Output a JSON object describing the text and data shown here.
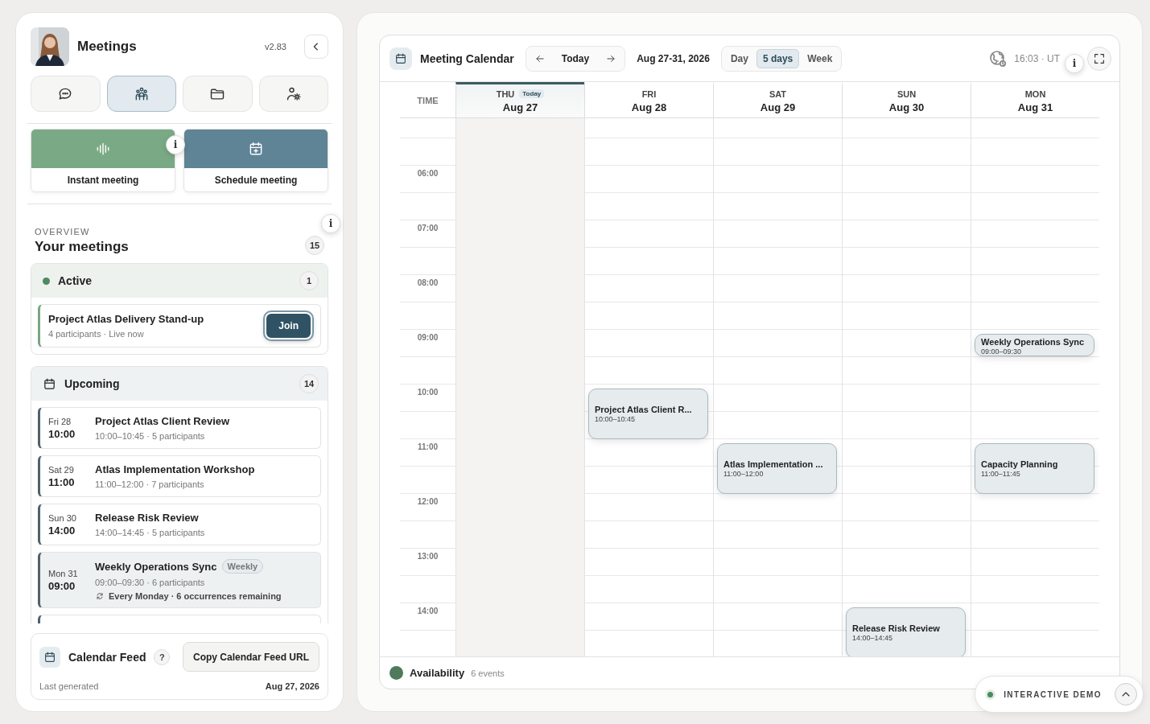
{
  "sidebar": {
    "title": "Meetings",
    "version": "v2.83",
    "tabs": [
      {
        "kind": "chat",
        "selected": false
      },
      {
        "kind": "people",
        "selected": true
      },
      {
        "kind": "folder",
        "selected": false
      },
      {
        "kind": "user-settings",
        "selected": false
      }
    ]
  },
  "actions": [
    {
      "kind": "instant",
      "label": "Instant meeting",
      "info": "i"
    },
    {
      "kind": "schedule",
      "label": "Schedule meeting"
    }
  ],
  "overview": {
    "eyebrow": "OVERVIEW",
    "title": "Your meetings",
    "count": "15",
    "info": "i"
  },
  "active": {
    "title": "Active",
    "count": "1",
    "items": [
      {
        "title": "Project Atlas Delivery Stand-up",
        "meta": "4 participants · Live now",
        "action": "Join"
      }
    ]
  },
  "upcoming": {
    "title": "Upcoming",
    "count": "14",
    "items": [
      {
        "day": "Fri 28",
        "time": "10:00",
        "title": "Project Atlas Client Review",
        "meta": "10:00–10:45 · 5 participants",
        "selected": false
      },
      {
        "day": "Sat 29",
        "time": "11:00",
        "title": "Atlas Implementation Workshop",
        "meta": "11:00–12:00 · 7 participants",
        "selected": false
      },
      {
        "day": "Sun 30",
        "time": "14:00",
        "title": "Release Risk Review",
        "meta": "14:00–14:45 · 5 participants",
        "selected": false
      },
      {
        "day": "Mon 31",
        "time": "09:00",
        "title": "Weekly Operations Sync",
        "badge": "Weekly",
        "meta": "09:00–09:30 · 6 participants",
        "recurrence": "Every Monday · 6 occurrences remaining",
        "selected": true
      }
    ]
  },
  "calendar_feed": {
    "title": "Calendar Feed",
    "help": "?",
    "button": "Copy Calendar Feed URL",
    "caption": "Last generated",
    "date": "Aug 27, 2026"
  },
  "calendar": {
    "title": "Meeting Calendar",
    "today_button": "Today",
    "range": "Aug 27-31, 2026",
    "views": [
      {
        "label": "Day",
        "selected": false
      },
      {
        "label": "5 days",
        "selected": true
      },
      {
        "label": "Week",
        "selected": false
      }
    ],
    "clock": "16:03 · UT",
    "info": "i",
    "time_header": "TIME",
    "days": [
      {
        "weekday": "THU",
        "date": "Aug 27",
        "today": true,
        "today_label": "Today"
      },
      {
        "weekday": "FRI",
        "date": "Aug 28",
        "today": false,
        "events": [
          {
            "title": "Project Atlas Client R...",
            "time": "10:00–10:45"
          }
        ]
      },
      {
        "weekday": "SAT",
        "date": "Aug 29",
        "today": false,
        "events": [
          {
            "title": "Atlas Implementation ...",
            "time": "11:00–12:00"
          }
        ]
      },
      {
        "weekday": "SUN",
        "date": "Aug 30",
        "today": false,
        "events": [
          {
            "title": "Release Risk Review",
            "time": "14:00–14:45"
          }
        ]
      },
      {
        "weekday": "MON",
        "date": "Aug 31",
        "today": false,
        "events": [
          {
            "title": "Weekly Operations Sync",
            "time": "09:00–09:30"
          },
          {
            "title": "Capacity Planning",
            "time": "11:00–11:45"
          }
        ]
      }
    ],
    "hours": [
      "06:00",
      "07:00",
      "08:00",
      "09:00",
      "10:00",
      "11:00",
      "12:00",
      "13:00",
      "14:00"
    ],
    "footer": {
      "title": "Availability",
      "count": "6 events"
    }
  },
  "demo": {
    "label": "INTERACTIVE DEMO"
  }
}
